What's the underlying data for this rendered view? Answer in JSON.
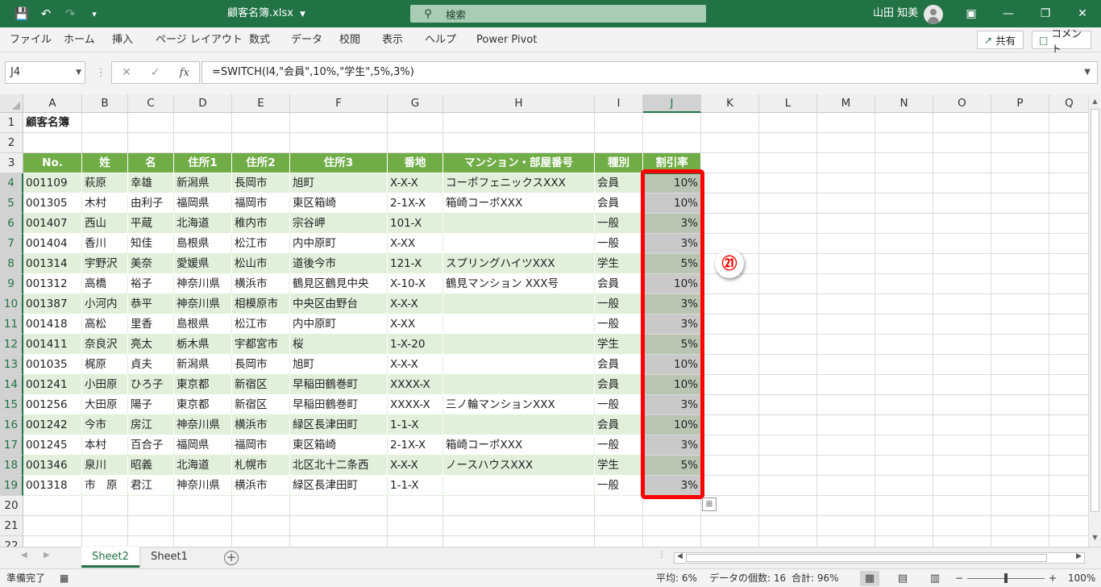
{
  "titlebar": {
    "filename": "顧客名簿.xlsx",
    "search_placeholder": "検索",
    "user": "山田 知美",
    "icons": [
      "save-icon",
      "undo-icon",
      "redo-icon",
      "customize-qat-icon",
      "ribbon-display-icon",
      "minimize-icon",
      "restore-icon",
      "close-icon"
    ]
  },
  "ribbon": {
    "tabs": [
      "ファイル",
      "ホーム",
      "挿入",
      "ページ レイアウト",
      "数式",
      "データ",
      "校閲",
      "表示",
      "ヘルプ",
      "Power Pivot"
    ],
    "share": "共有",
    "comment": "コメント"
  },
  "formula_bar": {
    "name_box": "J4",
    "formula": "=SWITCH(I4,\"会員\",10%,\"学生\",5%,3%)"
  },
  "grid": {
    "columns": [
      "A",
      "B",
      "C",
      "D",
      "E",
      "F",
      "G",
      "H",
      "I",
      "J",
      "K",
      "L",
      "M",
      "N",
      "O",
      "P",
      "Q"
    ],
    "rows": [
      "1",
      "2",
      "3",
      "4",
      "5",
      "6",
      "7",
      "8",
      "9",
      "10",
      "11",
      "12",
      "13",
      "14",
      "15",
      "16",
      "17",
      "18",
      "19",
      "20",
      "21",
      "22"
    ],
    "selected_column": "J",
    "selected_rows": [
      "4",
      "5",
      "6",
      "7",
      "8",
      "9",
      "10",
      "11",
      "12",
      "13",
      "14",
      "15",
      "16",
      "17",
      "18",
      "19"
    ],
    "title": "顧客名簿",
    "headers": [
      "No.",
      "姓",
      "名",
      "住所1",
      "住所2",
      "住所3",
      "番地",
      "マンション・部屋番号",
      "種別",
      "割引率"
    ],
    "records": [
      [
        "001109",
        "萩原",
        "幸雄",
        "新潟県",
        "長岡市",
        "旭町",
        "X-X-X",
        "コーポフェニックスXXX",
        "会員",
        "10%"
      ],
      [
        "001305",
        "木村",
        "由利子",
        "福岡県",
        "福岡市",
        "東区箱崎",
        "2-1X-X",
        "箱崎コーポXXX",
        "会員",
        "10%"
      ],
      [
        "001407",
        "西山",
        "平蔵",
        "北海道",
        "稚内市",
        "宗谷岬",
        "101-X",
        "",
        "一般",
        "3%"
      ],
      [
        "001404",
        "香川",
        "知佳",
        "島根県",
        "松江市",
        "内中原町",
        "X-XX",
        "",
        "一般",
        "3%"
      ],
      [
        "001314",
        "宇野沢",
        "美奈",
        "愛媛県",
        "松山市",
        "道後今市",
        "121-X",
        "スプリングハイツXXX",
        "学生",
        "5%"
      ],
      [
        "001312",
        "高橋",
        "裕子",
        "神奈川県",
        "横浜市",
        "鶴見区鶴見中央",
        "X-10-X",
        "鶴見マンション XXX号",
        "会員",
        "10%"
      ],
      [
        "001387",
        "小河内",
        "恭平",
        "神奈川県",
        "相模原市",
        "中央区由野台",
        "X-X-X",
        "",
        "一般",
        "3%"
      ],
      [
        "001418",
        "高松",
        "里香",
        "島根県",
        "松江市",
        "内中原町",
        "X-XX",
        "",
        "一般",
        "3%"
      ],
      [
        "001411",
        "奈良沢",
        "亮太",
        "栃木県",
        "宇都宮市",
        "桜",
        "1-X-20",
        "",
        "学生",
        "5%"
      ],
      [
        "001035",
        "梶原",
        "貞夫",
        "新潟県",
        "長岡市",
        "旭町",
        "X-X-X",
        "",
        "会員",
        "10%"
      ],
      [
        "001241",
        "小田原",
        "ひろ子",
        "東京都",
        "新宿区",
        "早稲田鶴巻町",
        "XXXX-X",
        "",
        "会員",
        "10%"
      ],
      [
        "001256",
        "大田原",
        "陽子",
        "東京都",
        "新宿区",
        "早稲田鶴巻町",
        "XXXX-X",
        "三ノ輪マンションXXX",
        "一般",
        "3%"
      ],
      [
        "001242",
        "今市",
        "房江",
        "神奈川県",
        "横浜市",
        "緑区長津田町",
        "1-1-X",
        "",
        "会員",
        "10%"
      ],
      [
        "001245",
        "本村",
        "百合子",
        "福岡県",
        "福岡市",
        "東区箱崎",
        "2-1X-X",
        "箱崎コーポXXX",
        "一般",
        "3%"
      ],
      [
        "001346",
        "泉川",
        "昭義",
        "北海道",
        "札幌市",
        "北区北十二条西",
        "X-X-X",
        "ノースハウスXXX",
        "学生",
        "5%"
      ],
      [
        "001318",
        "市　原",
        "君江",
        "神奈川県",
        "横浜市",
        "緑区長津田町",
        "1-1-X",
        "",
        "一般",
        "3%"
      ]
    ],
    "annotation": "㉑"
  },
  "sheets": {
    "tabs": [
      "Sheet2",
      "Sheet1"
    ],
    "active": "Sheet2"
  },
  "statusbar": {
    "ready": "準備完了",
    "average": "平均: 6%",
    "count": "データの個数: 16",
    "sum": "合計: 96%",
    "zoom": "100%"
  }
}
